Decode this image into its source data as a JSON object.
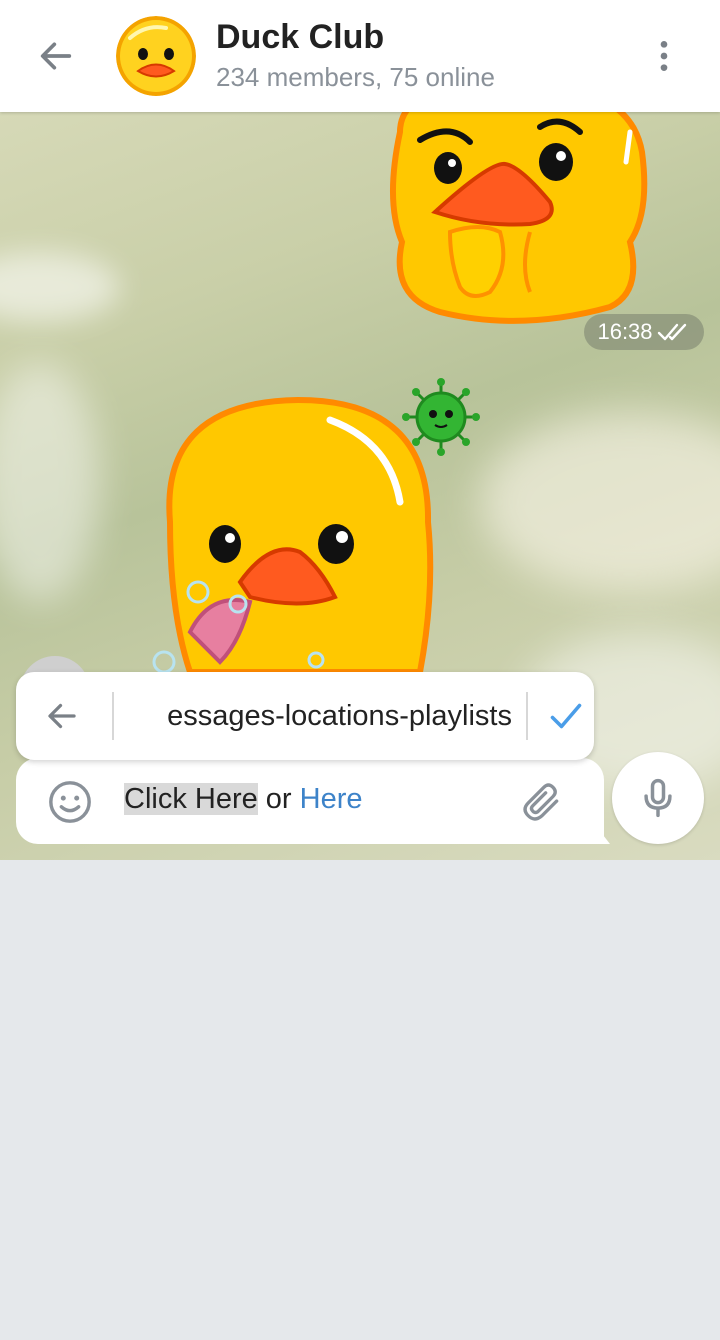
{
  "header": {
    "title": "Duck Club",
    "subtitle": "234 members, 75 online"
  },
  "messages": [
    {
      "type": "sticker",
      "name": "thinking-duck",
      "time": "16:38",
      "status": "read"
    },
    {
      "type": "sticker",
      "name": "duck-with-soap"
    }
  ],
  "link_editor": {
    "value": "essages-locations-playlists"
  },
  "composer": {
    "selected_text": "Click Here",
    "middle_text": " or ",
    "link_text": "Here"
  },
  "icons": {
    "back": "arrow-left-icon",
    "menu": "more-vertical-icon",
    "check": "check-icon",
    "emoji": "emoji-icon",
    "attach": "paperclip-icon",
    "mic": "microphone-icon"
  },
  "colors": {
    "accent": "#3d83c9",
    "check": "#4a9de8"
  }
}
